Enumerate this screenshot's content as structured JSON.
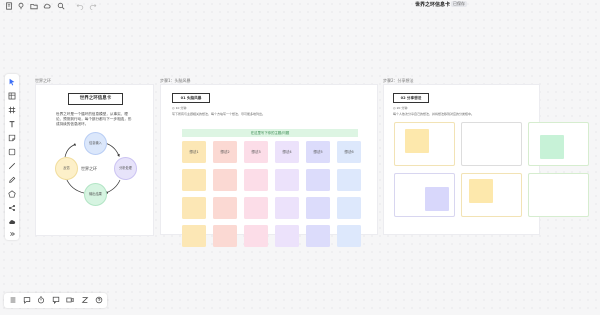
{
  "header": {
    "title": "世界之环信息卡",
    "badge": "已保存"
  },
  "frames": {
    "f1": {
      "label": "世界之环",
      "title": "世界之环信息卡",
      "description": "世界之环是一个循环的信息模型，从事实、理论、预测到行动，每个部分都与下一步相连，形成持续的信息闭环。",
      "center": "世界之环",
      "nodes": [
        "信息输入",
        "分析处理",
        "输出结果",
        "反馈"
      ]
    },
    "f2": {
      "label": "步骤1：头脑风暴",
      "button": "01 头脑风暴",
      "meta": "◎ 10 分钟",
      "description": "写下所有与主题相关的想法，每个方块写一个想法，尽可能多地列出。",
      "banner": "在这里写下你的主题/问题",
      "row_labels": [
        "想法1",
        "想法2",
        "想法3",
        "想法4",
        "想法5",
        "想法6"
      ]
    },
    "f3": {
      "label": "步骤2：分享想法",
      "button": "02 分享想法",
      "meta": "◎ 20 分钟",
      "description": "每个人依次分享自己的想法，并将想法移到对应的分类框中。"
    }
  },
  "colors": {
    "accent_blue": "#3b6ef6",
    "note_yellow": "#fde8ac",
    "note_green": "#c7f2d7",
    "note_purple": "#d8d7fb",
    "green_border": "#d6edcf",
    "yellow_border": "#f2e3b5",
    "purple_border": "#d8d6f0"
  },
  "toolbar": {
    "left_icons": [
      "pointer-icon",
      "table-icon",
      "frame-icon",
      "text-icon",
      "sticky-note-icon",
      "rectangle-icon",
      "line-icon",
      "pen-icon",
      "shape-icon",
      "connector-icon",
      "upload-icon",
      "more-icon"
    ],
    "bottom_icons": [
      "list-icon",
      "chat-icon",
      "timer-icon",
      "comment-icon",
      "video-icon",
      "zoom-icon",
      "help-icon"
    ]
  }
}
